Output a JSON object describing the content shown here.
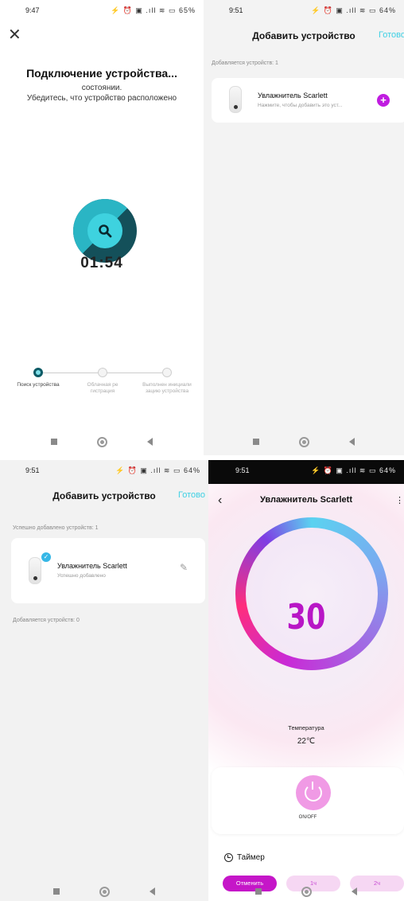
{
  "panel1": {
    "status_time": "9:47",
    "status_icons": "⚡ ⏰ ▣ .ıll ≋ ▭ 65%",
    "title": "Подключение устройства...",
    "sub_line1": "состоянии.",
    "sub_line2": "Убедитесь, что устройство расположено",
    "countdown": "01:54",
    "steps": [
      {
        "label": "Поиск устройства"
      },
      {
        "label": "Облачная ре гистрация"
      },
      {
        "label": "Выполнен инициали зацию устройства"
      }
    ]
  },
  "panel2": {
    "status_time": "9:51",
    "status_icons": "⚡ ⏰ ▣ .ıll ≋ ▭ 64%",
    "title": "Добавить устройство",
    "done": "Готово",
    "section": "Добавляется устройств: 1",
    "device_name": "Увлажнитель Scarlett",
    "device_sub": "Нажмите, чтобы добавить это уст..."
  },
  "panel3": {
    "status_time": "9:51",
    "status_icons": "⚡ ⏰ ▣ .ıll ≋ ▭ 64%",
    "title": "Добавить устройство",
    "done": "Готово",
    "section_success": "Успешно добавлено устройств: 1",
    "device_name": "Увлажнитель Scarlett",
    "device_sub": "Успешно добавлено",
    "section_adding": "Добавляется устройств: 0"
  },
  "panel4": {
    "status_time": "9:51",
    "status_icons": "⚡ ⏰ ▣ .ıll ≋ ▭ 64%",
    "device_title": "Увлажнитель Scarlett",
    "big_value": "30",
    "temp_label": "Температура",
    "temp_value": "22℃",
    "onoff_label": "ON/OFF",
    "timer_heading": "Таймер",
    "timer_buttons": [
      "Отменить",
      "1ч",
      "2ч"
    ]
  },
  "colors": {
    "accent_cyan": "#3fd0e4",
    "accent_magenta": "#c01ce0",
    "teal_dark": "#14505a"
  }
}
